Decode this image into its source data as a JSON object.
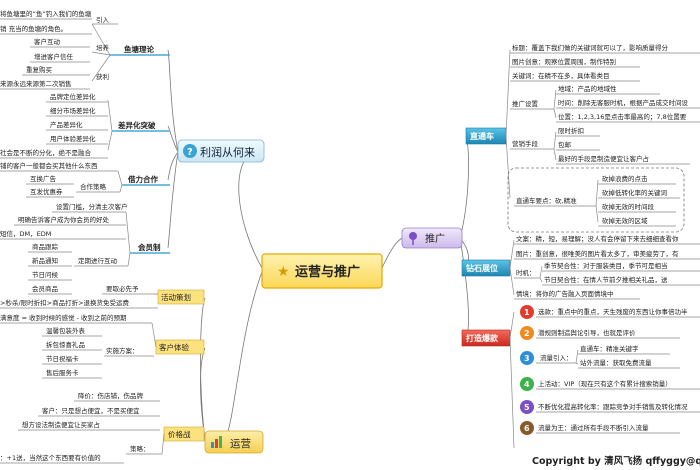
{
  "center": {
    "label": "运营与推广",
    "icon": "star-icon"
  },
  "colors": {
    "center_bg": "#fde98a",
    "center_border": "#e6a800",
    "profit_bg": "#d9eef6",
    "promo_bg": "#d8c7ef",
    "ops_bg": "#f7e4a4",
    "teal_bg": "#2a9fc7",
    "red_bg": "#e23b2b",
    "yellow_label_bg": "#fbe27f",
    "branch_teal": "#5aa9d6"
  },
  "profit": {
    "label": "利润从何来",
    "icon": "question-icon",
    "pond_theory": {
      "label": "鱼塘理论",
      "intro_label": "引入",
      "intro_items": [
        "将鱼塘里的“鱼”钓入我们的鱼塘",
        "销 充当的鱼塘的角色。"
      ],
      "nurture_label": "培养",
      "nurture_items": [
        "客户互动",
        "增进客户信任"
      ],
      "harvest_label": "获利",
      "harvest_items": [
        "重复购买",
        "来源永远来源第二次销售"
      ]
    },
    "diff": {
      "label": "差异化突破",
      "items": [
        "品牌定位差异化",
        "细分市场差异化",
        "产品差异化",
        "用户体验差异化",
        "社会是不断的分化，绝不是融合"
      ]
    },
    "coop": {
      "label": "借力合作",
      "intro": "铺的客户一般都会买其他什么东西",
      "sub_label": "合作策略",
      "sub_items": [
        "互换广告",
        "互发优惠券"
      ]
    },
    "member": {
      "label": "会员制",
      "items": [
        "设置门槛，分清主次客户",
        "明确告诉客户成为你会员的好处",
        "短信，DM，EDM"
      ],
      "push_label": "定期进行互动",
      "push_items": [
        "商品跟踪",
        "新品通知",
        "节日问候",
        "会员商品"
      ]
    }
  },
  "ops": {
    "label": "运营",
    "icon": "chart-icon",
    "event": {
      "label": "活动策划",
      "items": [
        "要取必先予",
        ">秒杀/限时折扣>商品打折>退换货免受运费"
      ]
    },
    "experience": {
      "label": "客户体验",
      "intro": "满意度 = 收到时候的感觉 - 收到之前的预期",
      "sub_label": "实施方案：",
      "sub_items": [
        "温馨包装外表",
        "拆包惊喜礼品",
        "节日祝福卡",
        "售后服务卡"
      ]
    },
    "price": {
      "label": "价格战",
      "items": [
        "降价：伤店铺，伤品牌",
        "客户：只是想占便宜，不是买便宜",
        "想方设法制造便宜让买家占"
      ],
      "strategy_label": "策略：",
      "strategy_item": "：+1送，当然这个东西要有价值的"
    }
  },
  "promo": {
    "label": "推广",
    "icon": "pin-icon",
    "through_train": {
      "label": "直通车",
      "title_item": "标题：覆盖下我们做的关键词就可以了，影响质量得分",
      "image_item": "图片创意：观察位置周围，制作特别",
      "keyword_item": "关键词：在精不在多，具体看类目",
      "settings": {
        "label": "推广设置",
        "items": [
          "地域：产品的地域性",
          "时间：削除无客服时机，根据产品成交时间设",
          "位置：1,2,3,16是点击率最高的；7,8位置要"
        ]
      },
      "marketing": {
        "label": "营销手段",
        "items": [
          "限时折扣",
          "包邮",
          "最好的手段是制造便宜让客户占"
        ]
      },
      "points": {
        "label": "直通车要点：砍,精准",
        "items": [
          "砍掉浪费的点击",
          "砍掉低转化率的关键词",
          "砍掉无效的时间段",
          "砍掉无效的区域"
        ]
      }
    },
    "diamond": {
      "label": "钻石展位",
      "copy_item": "文案：精，短，易理解；没人有会停留下来去细细查看你",
      "image_item": "图片：重创意，很唯美的图片看太多了，审美疲劳了，有",
      "timing": {
        "label": "时机：",
        "items": [
          "季节契合性：对于服装类目，季节可是相当",
          "节日契合性：在情人节前夕推相关礼品，送"
        ]
      },
      "scene_item": "情境：将你的广告融入页面情境中"
    },
    "hot": {
      "label": "打造爆款",
      "steps": [
        {
          "num": "1",
          "text": "选款：重点中的重点，天生残废的东西让你事倍功半"
        },
        {
          "num": "2",
          "text": "潜规则制造舆论引导，也就是评价"
        },
        {
          "num": "3",
          "text": "流量引入：",
          "subs": [
            "直通车：精准关键字",
            "站外流量：获取免费流量"
          ]
        },
        {
          "num": "4",
          "text": "上活动：VIP（现在只有这个有累计搜索销量）"
        },
        {
          "num": "5",
          "text": "不断优化提高转化率：跟踪竞争对手销售及转化情况"
        },
        {
          "num": "6",
          "text": "流量为王：通过所有手段不断引入流量"
        }
      ]
    }
  },
  "watermark": "Copyright by 清风飞扬  qffyggy@q"
}
